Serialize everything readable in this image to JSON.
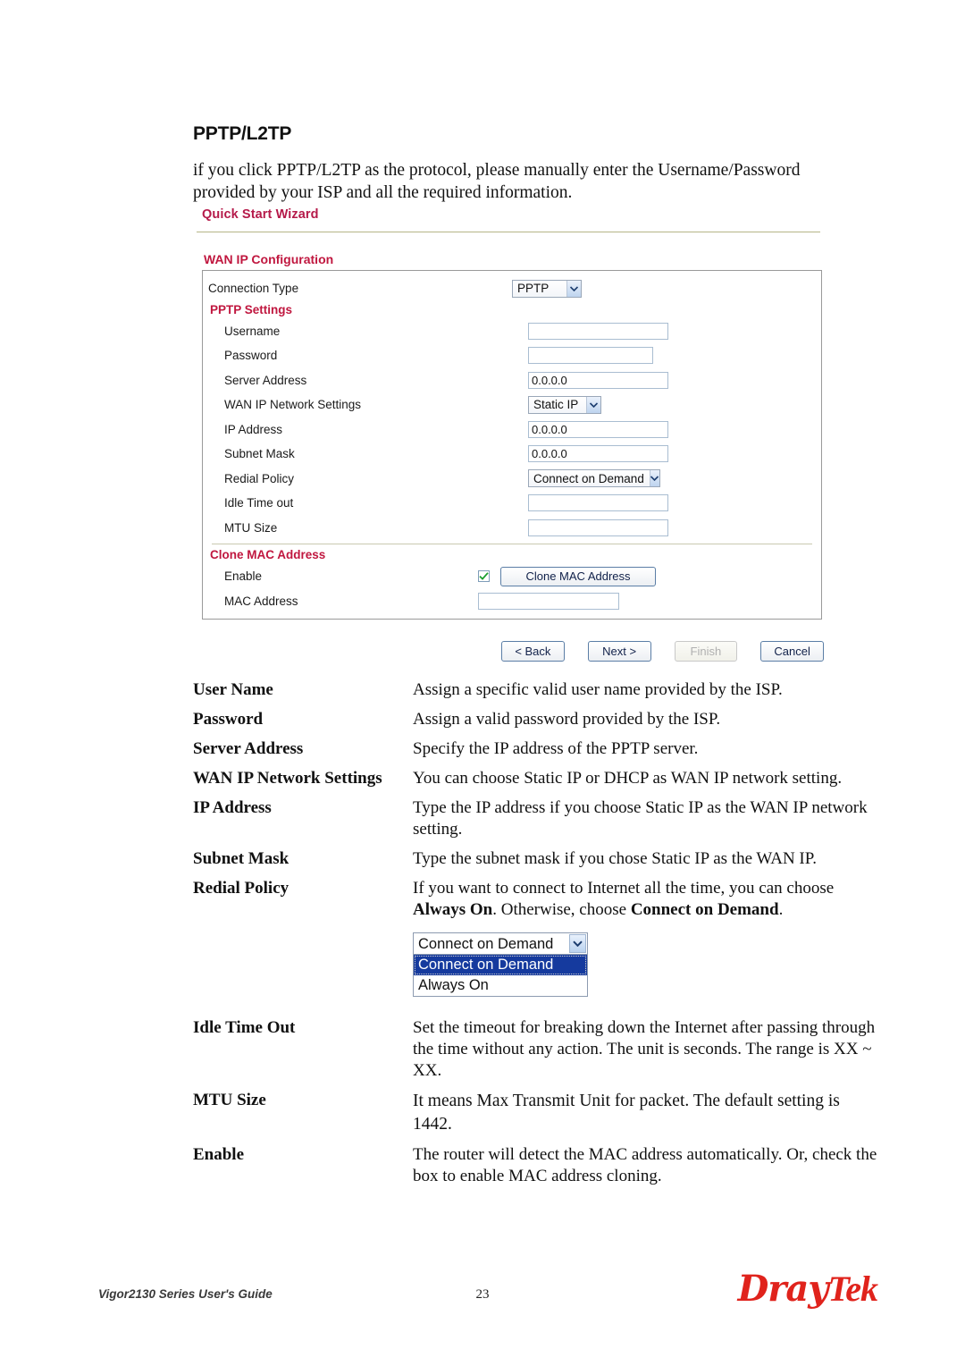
{
  "document": {
    "section_title": "PPTP/L2TP",
    "intro_paragraph": "if you click PPTP/L2TP as the protocol, please manually enter the Username/Password provided by your ISP and all the required information."
  },
  "router_ui": {
    "wizard_title": "Quick Start Wizard",
    "group_title": "WAN IP Configuration",
    "connection_type_label": "Connection Type",
    "connection_type_value": "PPTP",
    "pptp_settings_title": "PPTP Settings",
    "fields": [
      {
        "label": "Username",
        "type": "text",
        "value": ""
      },
      {
        "label": "Password",
        "type": "text",
        "value": ""
      },
      {
        "label": "Server Address",
        "type": "text",
        "value": "0.0.0.0"
      },
      {
        "label": "WAN IP Network Settings",
        "type": "select",
        "value": "Static IP"
      },
      {
        "label": "IP Address",
        "type": "text",
        "value": "0.0.0.0"
      },
      {
        "label": "Subnet Mask",
        "type": "text",
        "value": "0.0.0.0"
      },
      {
        "label": "Redial Policy",
        "type": "select",
        "value": "Connect on Demand"
      },
      {
        "label": "Idle Time out",
        "type": "text",
        "value": ""
      },
      {
        "label": "MTU Size",
        "type": "text",
        "value": ""
      }
    ],
    "clone_mac": {
      "group_title": "Clone MAC Address",
      "enable_label": "Enable",
      "enable_checked": true,
      "clone_button_label": "Clone MAC Address",
      "mac_address_label": "MAC Address",
      "mac_address_value": ""
    },
    "nav_buttons": {
      "back": "< Back",
      "next": "Next >",
      "finish": "Finish",
      "cancel": "Cancel"
    }
  },
  "definitions": [
    {
      "term": "User Name",
      "desc": "Assign a specific valid user name provided by the ISP."
    },
    {
      "term": "Password",
      "desc": "Assign a valid password provided by the ISP."
    },
    {
      "term": "Server Address",
      "desc": "Specify the IP address of the PPTP server."
    },
    {
      "term": "WAN IP Network Settings",
      "desc": "You can choose Static IP or DHCP as WAN IP network setting."
    },
    {
      "term": "IP Address",
      "desc": "Type the IP address if you choose Static IP as the WAN IP network setting."
    },
    {
      "term": "Subnet Mask",
      "desc": "Type the subnet mask if you chose Static IP as the WAN IP."
    }
  ],
  "redial_policy": {
    "term": "Redial Policy",
    "desc_part1": "If you want to connect to Internet all the time, you can choose ",
    "desc_bold1": "Always On",
    "desc_part2": ". Otherwise, choose ",
    "desc_bold2": "Connect on Demand",
    "desc_part3": ".",
    "dropdown_value": "Connect on Demand",
    "dropdown_options": [
      "Connect on Demand",
      "Always On"
    ],
    "dropdown_selected_index": 0
  },
  "definitions_tail": [
    {
      "term": "Idle Time Out",
      "desc": "Set the timeout for breaking down the Internet after passing through the time without any action. The unit is seconds. The range is XX ~ XX."
    },
    {
      "term": "MTU Size",
      "desc": "It means Max Transmit Unit for packet. The default setting is 1442."
    },
    {
      "term": "Enable",
      "desc": "The router will detect the MAC address automatically. Or, check the box to enable MAC address cloning."
    }
  ],
  "footer": {
    "guide_title": "Vigor2130 Series User's Guide",
    "page_number": "23",
    "logo_text_1": "Dray",
    "logo_text_2": "Tek"
  },
  "colors": {
    "heading_red": "#c0173f",
    "logo_red": "#e0231c",
    "rule_olive": "#b5b587",
    "select_highlight": "#153a9e"
  }
}
